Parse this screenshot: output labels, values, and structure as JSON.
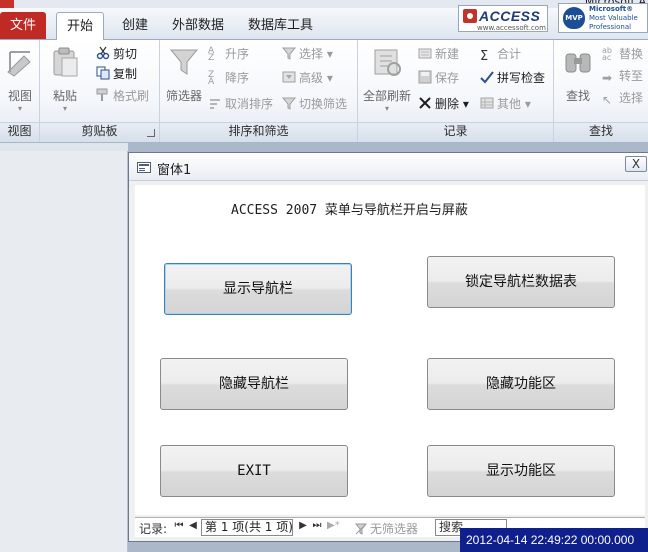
{
  "window": {
    "title_fragment": "Microsoft A"
  },
  "tabs": [
    {
      "label": "文件"
    },
    {
      "label": "开始"
    },
    {
      "label": "创建"
    },
    {
      "label": "外部数据"
    },
    {
      "label": "数据库工具"
    }
  ],
  "brand": {
    "access_word": "ACCESS",
    "access_url": "www.accessoft.com",
    "mvp_badge": "MVP",
    "mvp_line1": "Microsoft®",
    "mvp_line2": "Most Valuable",
    "mvp_line3": "Professional"
  },
  "ribbon": {
    "view": {
      "big_label": "视图",
      "group_label": "视图"
    },
    "clipboard": {
      "paste": "粘贴",
      "cut": "剪切",
      "copy": "复制",
      "format_painter": "格式刷",
      "group_label": "剪贴板"
    },
    "sort_filter": {
      "filter": "筛选器",
      "ascending": "升序",
      "descending": "降序",
      "remove_sort": "取消排序",
      "selection": "选择",
      "advanced": "高级",
      "toggle_filter": "切换筛选",
      "group_label": "排序和筛选"
    },
    "records": {
      "refresh_all": "全部刷新",
      "new": "新建",
      "save": "保存",
      "delete": "删除",
      "totals": "合计",
      "spelling": "拼写检查",
      "more": "其他",
      "group_label": "记录"
    },
    "find": {
      "find": "查找",
      "replace": "替换",
      "goto": "转至",
      "select": "选择",
      "group_label": "查找"
    }
  },
  "form": {
    "caption": "窗体1",
    "close_glyph": "X",
    "heading": "ACCESS 2007 菜单与导航栏开启与屏蔽",
    "buttons": {
      "show_nav": "显示导航栏",
      "lock_nav": "锁定导航栏数据表",
      "hide_nav": "隐藏导航栏",
      "hide_ribbon": "隐藏功能区",
      "exit": "EXIT",
      "show_ribbon": "显示功能区"
    },
    "record_nav": {
      "label": "记录:",
      "position": "第 1 项(共 1 项)",
      "no_filter": "无筛选器",
      "search": "搜索"
    }
  },
  "clock": {
    "text": "2012-04-14 22:49:22 00:00.000"
  },
  "colors": {
    "file_tab": "#bf2a25",
    "clock_bg": "#0f1f8c",
    "focus_border": "#3c7fb1"
  }
}
